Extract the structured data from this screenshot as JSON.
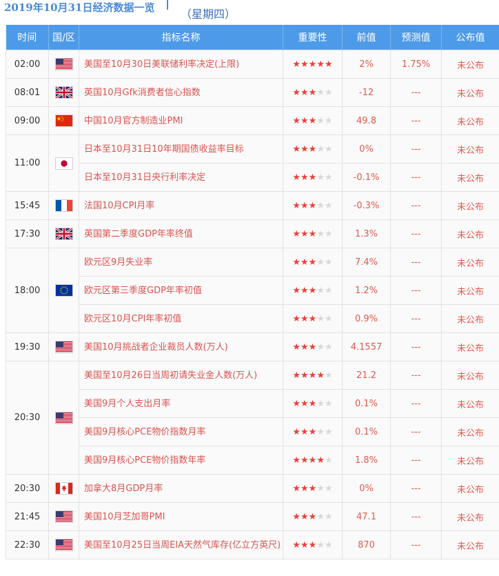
{
  "title": "2019年10月31日经济数据一览",
  "weekday": "（星期四）",
  "columns": [
    "时间",
    "国/区",
    "指标名称",
    "重要性",
    "前值",
    "预测值",
    "公布值"
  ],
  "groups": [
    {
      "time": "02:00",
      "flag": "us-flag-icon",
      "rows": [
        {
          "name": "美国至10月30日美联储利率决定(上限)",
          "stars": 5,
          "prev": "2%",
          "forecast": "1.75%",
          "published": "未公布"
        }
      ]
    },
    {
      "time": "08:01",
      "flag": "uk-flag-icon",
      "rows": [
        {
          "name": "英国10月Gfk消费者信心指数",
          "stars": 3,
          "prev": "-12",
          "forecast": "---",
          "published": "未公布"
        }
      ]
    },
    {
      "time": "09:00",
      "flag": "china-flag-icon",
      "rows": [
        {
          "name": "中国10月官方制造业PMI",
          "stars": 3,
          "prev": "49.8",
          "forecast": "---",
          "published": "未公布"
        }
      ]
    },
    {
      "time": "11:00",
      "flag": "japan-flag-icon",
      "rows": [
        {
          "name": "日本至10月31日10年期国债收益率目标",
          "stars": 3,
          "prev": "0%",
          "forecast": "---",
          "published": "未公布"
        },
        {
          "name": "日本至10月31日央行利率决定",
          "stars": 3,
          "prev": "-0.1%",
          "forecast": "---",
          "published": "未公布"
        }
      ]
    },
    {
      "time": "15:45",
      "flag": "france-flag-icon",
      "rows": [
        {
          "name": "法国10月CPI月率",
          "stars": 3,
          "prev": "-0.3%",
          "forecast": "---",
          "published": "未公布"
        }
      ]
    },
    {
      "time": "17:30",
      "flag": "uk-flag-icon",
      "rows": [
        {
          "name": "英国第二季度GDP年率终值",
          "stars": 3,
          "prev": "1.3%",
          "forecast": "---",
          "published": "未公布"
        }
      ]
    },
    {
      "time": "18:00",
      "flag": "eu-flag-icon",
      "rows": [
        {
          "name": "欧元区9月失业率",
          "stars": 3,
          "prev": "7.4%",
          "forecast": "---",
          "published": "未公布"
        },
        {
          "name": "欧元区第三季度GDP年率初值",
          "stars": 3,
          "prev": "1.2%",
          "forecast": "---",
          "published": "未公布"
        },
        {
          "name": "欧元区10月CPI年率初值",
          "stars": 3,
          "prev": "0.9%",
          "forecast": "---",
          "published": "未公布"
        }
      ]
    },
    {
      "time": "19:30",
      "flag": "us-flag-icon",
      "rows": [
        {
          "name": "美国10月挑战者企业裁员人数(万人)",
          "stars": 3,
          "prev": "4.1557",
          "forecast": "---",
          "published": "未公布"
        }
      ]
    },
    {
      "time": "20:30",
      "flag": "us-flag-icon",
      "rows": [
        {
          "name": "美国至10月26日当周初请失业金人数(万人)",
          "stars": 4,
          "prev": "21.2",
          "forecast": "---",
          "published": "未公布"
        },
        {
          "name": "美国9月个人支出月率",
          "stars": 3,
          "prev": "0.1%",
          "forecast": "---",
          "published": "未公布"
        },
        {
          "name": "美国9月核心PCE物价指数月率",
          "stars": 3,
          "prev": "0.1%",
          "forecast": "---",
          "published": "未公布"
        },
        {
          "name": "美国9月核心PCE物价指数年率",
          "stars": 4,
          "prev": "1.8%",
          "forecast": "---",
          "published": "未公布"
        }
      ]
    },
    {
      "time": "20:30",
      "flag": "canada-flag-icon",
      "rows": [
        {
          "name": "加拿大8月GDP月率",
          "stars": 3,
          "prev": "0%",
          "forecast": "---",
          "published": "未公布"
        }
      ]
    },
    {
      "time": "21:45",
      "flag": "us-flag-icon",
      "rows": [
        {
          "name": "美国10月芝加哥PMI",
          "stars": 3,
          "prev": "47.1",
          "forecast": "---",
          "published": "未公布"
        }
      ]
    },
    {
      "time": "22:30",
      "flag": "us-flag-icon",
      "rows": [
        {
          "name": "美国至10月25日当周EIA天然气库存(亿立方英尺)",
          "stars": 3,
          "prev": "870",
          "forecast": "---",
          "published": "未公布"
        }
      ]
    }
  ],
  "colors": {
    "header_bg": "#4d9be8",
    "name_text": "#d9534f",
    "star_on": "#e8403a",
    "star_off": "#d8d8d8"
  }
}
